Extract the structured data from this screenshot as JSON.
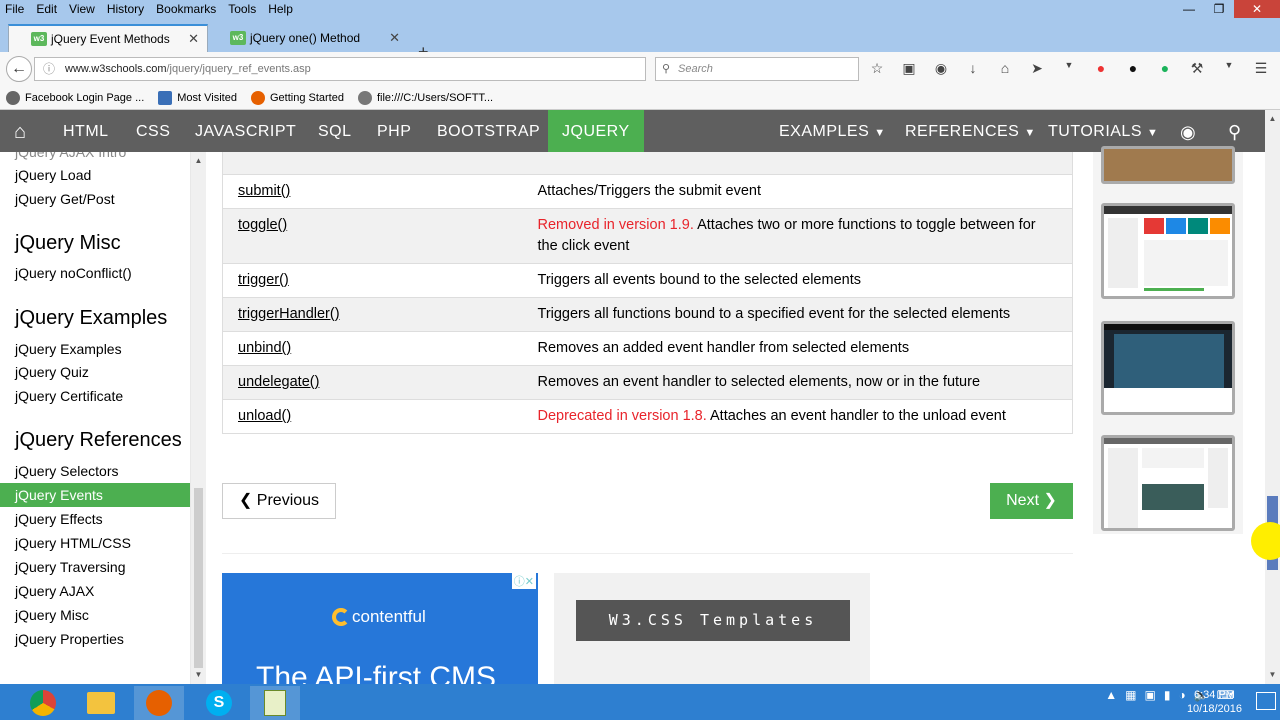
{
  "menu": [
    "File",
    "Edit",
    "View",
    "History",
    "Bookmarks",
    "Tools",
    "Help"
  ],
  "tabs": [
    {
      "label": "jQuery Event Methods",
      "active": true
    },
    {
      "label": "jQuery one() Method",
      "active": false
    }
  ],
  "url": {
    "host": "www.w3schools.com",
    "path": "/jquery/jquery_ref_events.asp"
  },
  "search_placeholder": "Search",
  "bookmarks": [
    "Facebook Login Page ...",
    "Most Visited",
    "Getting Started",
    "file:///C:/Users/SOFTT..."
  ],
  "topnav": {
    "items": [
      "HTML",
      "CSS",
      "JAVASCRIPT",
      "SQL",
      "PHP",
      "BOOTSTRAP",
      "JQUERY"
    ],
    "active": "JQUERY",
    "dropdowns": [
      "EXAMPLES",
      "REFERENCES",
      "TUTORIALS"
    ]
  },
  "sidebar": {
    "partial_top": "jQuery AJAX Intro",
    "links_top": [
      "jQuery Load",
      "jQuery Get/Post"
    ],
    "misc_heading": "jQuery Misc",
    "misc_links": [
      "jQuery noConflict()"
    ],
    "examples_heading": "jQuery Examples",
    "examples_links": [
      "jQuery Examples",
      "jQuery Quiz",
      "jQuery Certificate"
    ],
    "references_heading": "jQuery References",
    "references_links": [
      "jQuery Selectors",
      "jQuery Events",
      "jQuery Effects",
      "jQuery HTML/CSS",
      "jQuery Traversing",
      "jQuery AJAX",
      "jQuery Misc",
      "jQuery Properties"
    ],
    "active": "jQuery Events"
  },
  "table": {
    "rows": [
      {
        "method": "submit()",
        "note": "",
        "desc": "Attaches/Triggers the submit event"
      },
      {
        "method": "toggle()",
        "note": "Removed in version 1.9.",
        "desc": " Attaches two or more functions to toggle between for the click event"
      },
      {
        "method": "trigger()",
        "note": "",
        "desc": "Triggers all events bound to the selected elements"
      },
      {
        "method": "triggerHandler()",
        "note": "",
        "desc": "Triggers all functions bound to a specified event for the selected elements"
      },
      {
        "method": "unbind()",
        "note": "",
        "desc": "Removes an added event handler from selected elements"
      },
      {
        "method": "undelegate()",
        "note": "",
        "desc": "Removes an event handler to selected elements, now or in the future"
      },
      {
        "method": "unload()",
        "note": "Deprecated in version 1.8.",
        "desc": " Attaches an event handler to the unload event"
      }
    ]
  },
  "pager": {
    "prev": "❮ Previous",
    "next": "Next ❯"
  },
  "ad": {
    "brand": "contentful",
    "tagline": "The API-first CMS"
  },
  "templates_button": "W3.CSS Templates",
  "clock": {
    "time": "6:34 PM",
    "date": "10/18/2016"
  },
  "colors": {
    "accent": "#4caf50",
    "nav_bg": "#5f5f5f",
    "note_red": "#e8242b",
    "taskbar": "#2e7fd0"
  }
}
